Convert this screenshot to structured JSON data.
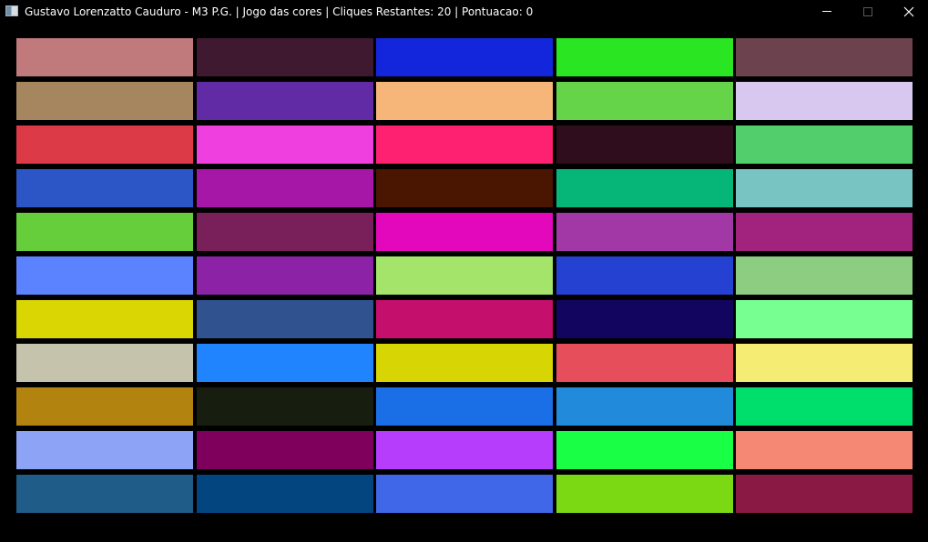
{
  "window": {
    "title": "Gustavo Lorenzatto Cauduro - M3 P.G. | Jogo das cores | Cliques Restantes: 20 | Pontuacao: 0",
    "controls": {
      "minimize_icon": "minimize-icon",
      "maximize_icon": "maximize-icon",
      "close_icon": "close-icon"
    }
  },
  "board": {
    "columns": 5,
    "rows": 11,
    "background": "#000000",
    "tiles": [
      [
        "#C07A7B",
        "#3E1930",
        "#1326DC",
        "#2AE622",
        "#6B424D"
      ],
      [
        "#A6865E",
        "#622BA6",
        "#F6B679",
        "#66D448",
        "#D8C8EF"
      ],
      [
        "#DD3A47",
        "#EF40DF",
        "#FE2171",
        "#2F0D1C",
        "#53CE6C"
      ],
      [
        "#2C56C5",
        "#A617A8",
        "#4A1501",
        "#05B678",
        "#78C4C2"
      ],
      [
        "#66CE3A",
        "#791F5A",
        "#E408BC",
        "#A238A6",
        "#A2237D"
      ],
      [
        "#5C83FF",
        "#8C23A7",
        "#A4E46B",
        "#2441D1",
        "#8CCD82"
      ],
      [
        "#D9D604",
        "#30538F",
        "#C50F6D",
        "#120560",
        "#78FF92"
      ],
      [
        "#C5C3AC",
        "#1F84FE",
        "#D7D604",
        "#E74E5B",
        "#F5EC73"
      ],
      [
        "#B3830F",
        "#171D0F",
        "#1B6FE6",
        "#218ADB",
        "#00DE6B"
      ],
      [
        "#8DA4F6",
        "#7F005C",
        "#B73DFD",
        "#19FF45",
        "#F48875"
      ],
      [
        "#1F5C87",
        "#02457F",
        "#3F67E8",
        "#7AD913",
        "#8A1944"
      ]
    ]
  }
}
